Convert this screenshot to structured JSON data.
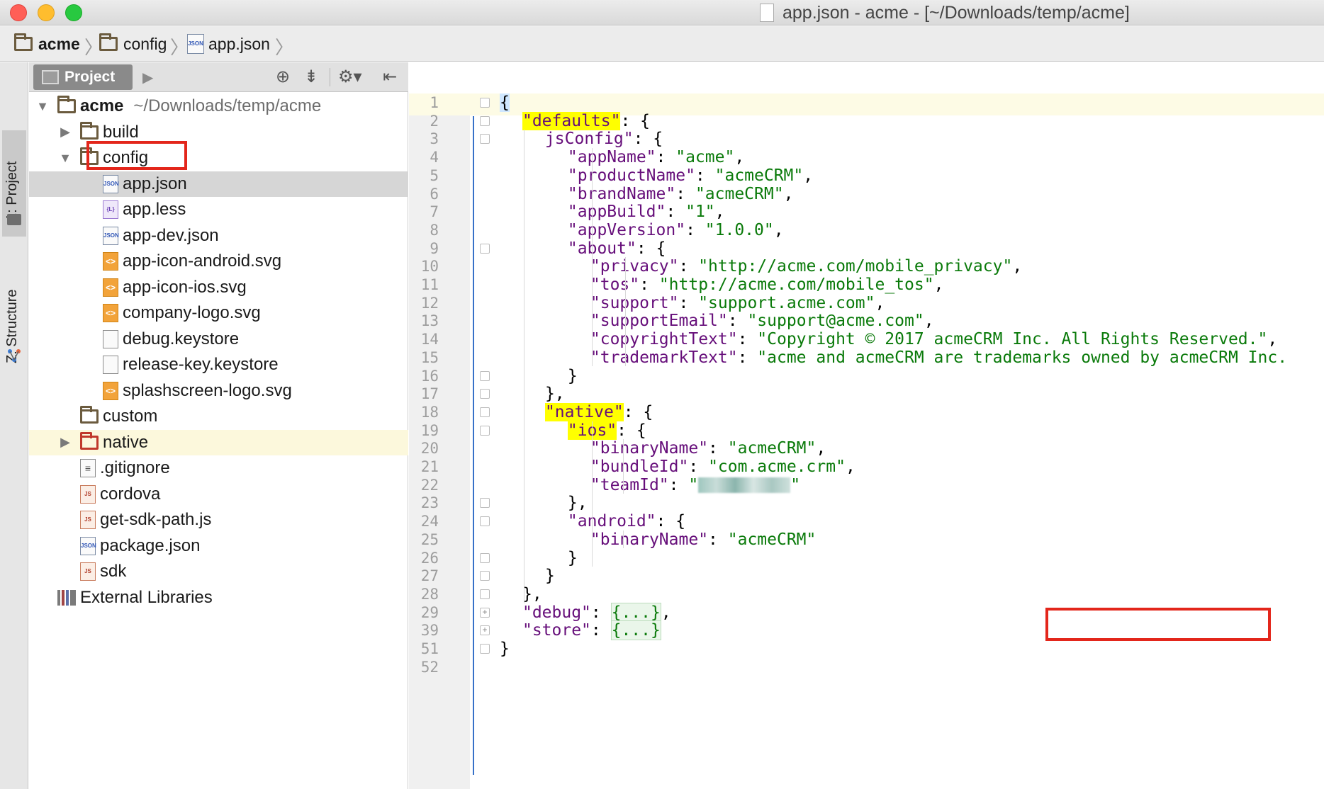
{
  "window": {
    "title": "app.json - acme - [~/Downloads/temp/acme]"
  },
  "breadcrumb": [
    "acme",
    "config",
    "app.json"
  ],
  "tool_strip": {
    "project_tab": "1: Project",
    "structure_tab": "Z: Structure"
  },
  "project_panel": {
    "tab_label": "Project",
    "toolbar_icons": [
      "locate-icon",
      "collapse-all-icon",
      "settings-icon",
      "hide-panel-icon"
    ],
    "tree": [
      {
        "label": "acme",
        "path": "~/Downloads/temp/acme",
        "icon": "folder-icon",
        "arrow": "expanded",
        "indent": 0,
        "bold": true
      },
      {
        "label": "build",
        "path": "",
        "icon": "folder-icon",
        "arrow": "collapsed",
        "indent": 1
      },
      {
        "label": "config",
        "path": "",
        "icon": "folder-icon",
        "arrow": "expanded",
        "indent": 1
      },
      {
        "label": "app.json",
        "path": "",
        "icon": "json-file-icon",
        "arrow": "none",
        "indent": 2,
        "selected": true
      },
      {
        "label": "app.less",
        "path": "",
        "icon": "less-file-icon",
        "arrow": "none",
        "indent": 2
      },
      {
        "label": "app-dev.json",
        "path": "",
        "icon": "json-file-icon",
        "arrow": "none",
        "indent": 2
      },
      {
        "label": "app-icon-android.svg",
        "path": "",
        "icon": "svg-file-icon",
        "arrow": "none",
        "indent": 2
      },
      {
        "label": "app-icon-ios.svg",
        "path": "",
        "icon": "svg-file-icon",
        "arrow": "none",
        "indent": 2
      },
      {
        "label": "company-logo.svg",
        "path": "",
        "icon": "svg-file-icon",
        "arrow": "none",
        "indent": 2
      },
      {
        "label": "debug.keystore",
        "path": "",
        "icon": "plain-file-icon",
        "arrow": "none",
        "indent": 2
      },
      {
        "label": "release-key.keystore",
        "path": "",
        "icon": "plain-file-icon",
        "arrow": "none",
        "indent": 2
      },
      {
        "label": "splashscreen-logo.svg",
        "path": "",
        "icon": "svg-file-icon",
        "arrow": "none",
        "indent": 2
      },
      {
        "label": "custom",
        "path": "",
        "icon": "folder-icon",
        "arrow": "none",
        "indent": 1
      },
      {
        "label": "native",
        "path": "",
        "icon": "excluded-folder-icon",
        "arrow": "collapsed",
        "indent": 1,
        "excluded": true
      },
      {
        "label": ".gitignore",
        "path": "",
        "icon": "text-file-icon",
        "arrow": "none",
        "indent": 1
      },
      {
        "label": "cordova",
        "path": "",
        "icon": "js-file-icon",
        "arrow": "none",
        "indent": 1
      },
      {
        "label": "get-sdk-path.js",
        "path": "",
        "icon": "js-file-icon",
        "arrow": "none",
        "indent": 1
      },
      {
        "label": "package.json",
        "path": "",
        "icon": "json-file-icon",
        "arrow": "none",
        "indent": 1
      },
      {
        "label": "sdk",
        "path": "",
        "icon": "js-file-icon",
        "arrow": "none",
        "indent": 1
      },
      {
        "label": "External Libraries",
        "path": "",
        "icon": "library-icon",
        "arrow": "none",
        "indent": 0
      }
    ]
  },
  "editor": {
    "lines": [
      {
        "n": "1",
        "fold": "open",
        "indent": 0,
        "parts": [
          [
            "br",
            "{"
          ]
        ]
      },
      {
        "n": "2",
        "fold": "open",
        "indent": 2,
        "parts": [
          [
            "k hl",
            "\"defaults\""
          ],
          [
            "p",
            ": {"
          ]
        ]
      },
      {
        "n": "3",
        "fold": "open",
        "indent": 4,
        "parts": [
          [
            "k",
            "jsConfig\""
          ],
          [
            "p",
            ": {"
          ]
        ]
      },
      {
        "n": "4",
        "fold": "",
        "indent": 6,
        "parts": [
          [
            "k",
            "\"appName\""
          ],
          [
            "p",
            ": "
          ],
          [
            "s",
            "\"acme\""
          ],
          [
            "p",
            ","
          ]
        ]
      },
      {
        "n": "5",
        "fold": "",
        "indent": 6,
        "parts": [
          [
            "k",
            "\"productName\""
          ],
          [
            "p",
            ": "
          ],
          [
            "s",
            "\"acmeCRM\""
          ],
          [
            "p",
            ","
          ]
        ]
      },
      {
        "n": "6",
        "fold": "",
        "indent": 6,
        "parts": [
          [
            "k",
            "\"brandName\""
          ],
          [
            "p",
            ": "
          ],
          [
            "s",
            "\"acmeCRM\""
          ],
          [
            "p",
            ","
          ]
        ]
      },
      {
        "n": "7",
        "fold": "",
        "indent": 6,
        "parts": [
          [
            "k",
            "\"appBuild\""
          ],
          [
            "p",
            ": "
          ],
          [
            "s",
            "\"1\""
          ],
          [
            "p",
            ","
          ]
        ]
      },
      {
        "n": "8",
        "fold": "",
        "indent": 6,
        "parts": [
          [
            "k",
            "\"appVersion\""
          ],
          [
            "p",
            ": "
          ],
          [
            "s",
            "\"1.0.0\""
          ],
          [
            "p",
            ","
          ]
        ]
      },
      {
        "n": "9",
        "fold": "open",
        "indent": 6,
        "parts": [
          [
            "k",
            "\"about\""
          ],
          [
            "p",
            ": {"
          ]
        ]
      },
      {
        "n": "10",
        "fold": "",
        "indent": 8,
        "parts": [
          [
            "k",
            "\"privacy\""
          ],
          [
            "p",
            ": "
          ],
          [
            "s",
            "\"http://acme.com/mobile_privacy\""
          ],
          [
            "p",
            ","
          ]
        ]
      },
      {
        "n": "11",
        "fold": "",
        "indent": 8,
        "parts": [
          [
            "k",
            "\"tos\""
          ],
          [
            "p",
            ": "
          ],
          [
            "s",
            "\"http://acme.com/mobile_tos\""
          ],
          [
            "p",
            ","
          ]
        ]
      },
      {
        "n": "12",
        "fold": "",
        "indent": 8,
        "parts": [
          [
            "k",
            "\"support\""
          ],
          [
            "p",
            ": "
          ],
          [
            "s",
            "\"support.acme.com\""
          ],
          [
            "p",
            ","
          ]
        ]
      },
      {
        "n": "13",
        "fold": "",
        "indent": 8,
        "parts": [
          [
            "k",
            "\"supportEmail\""
          ],
          [
            "p",
            ": "
          ],
          [
            "s",
            "\"support@acme.com\""
          ],
          [
            "p",
            ","
          ]
        ]
      },
      {
        "n": "14",
        "fold": "",
        "indent": 8,
        "parts": [
          [
            "k",
            "\"copyrightText\""
          ],
          [
            "p",
            ": "
          ],
          [
            "s",
            "\"Copyright © 2017 acmeCRM Inc. All Rights Reserved.\""
          ],
          [
            "p",
            ","
          ]
        ]
      },
      {
        "n": "15",
        "fold": "",
        "indent": 8,
        "parts": [
          [
            "k",
            "\"trademarkText\""
          ],
          [
            "p",
            ": "
          ],
          [
            "s",
            "\"acme and acmeCRM are trademarks owned by acmeCRM Inc."
          ]
        ]
      },
      {
        "n": "16",
        "fold": "close",
        "indent": 6,
        "parts": [
          [
            "p",
            "}"
          ]
        ]
      },
      {
        "n": "17",
        "fold": "close",
        "indent": 4,
        "parts": [
          [
            "p",
            "},"
          ]
        ]
      },
      {
        "n": "18",
        "fold": "open",
        "indent": 4,
        "parts": [
          [
            "k hl",
            "\"native\""
          ],
          [
            "p",
            ": {"
          ]
        ]
      },
      {
        "n": "19",
        "fold": "open",
        "indent": 6,
        "parts": [
          [
            "k hl",
            "\"ios\""
          ],
          [
            "p",
            ": {"
          ]
        ]
      },
      {
        "n": "20",
        "fold": "",
        "indent": 8,
        "parts": [
          [
            "k",
            "\"binaryName\""
          ],
          [
            "p",
            ": "
          ],
          [
            "s",
            "\"acmeCRM\""
          ],
          [
            "p",
            ","
          ]
        ]
      },
      {
        "n": "21",
        "fold": "",
        "indent": 8,
        "parts": [
          [
            "k",
            "\"bundleId\""
          ],
          [
            "p",
            ": "
          ],
          [
            "s",
            "\"com.acme.crm\""
          ],
          [
            "p",
            ","
          ]
        ]
      },
      {
        "n": "22",
        "fold": "",
        "indent": 8,
        "parts": [
          [
            "k",
            "\"teamId\""
          ],
          [
            "p",
            ": "
          ],
          [
            "s",
            "\""
          ],
          [
            "blur",
            ""
          ],
          [
            "s",
            "\""
          ]
        ]
      },
      {
        "n": "23",
        "fold": "close",
        "indent": 6,
        "parts": [
          [
            "p",
            "},"
          ]
        ]
      },
      {
        "n": "24",
        "fold": "open",
        "indent": 6,
        "parts": [
          [
            "k",
            "\"android\""
          ],
          [
            "p",
            ": {"
          ]
        ]
      },
      {
        "n": "25",
        "fold": "",
        "indent": 8,
        "parts": [
          [
            "k",
            "\"binaryName\""
          ],
          [
            "p",
            ": "
          ],
          [
            "s",
            "\"acmeCRM\""
          ]
        ]
      },
      {
        "n": "26",
        "fold": "close",
        "indent": 6,
        "parts": [
          [
            "p",
            "}"
          ]
        ]
      },
      {
        "n": "27",
        "fold": "close",
        "indent": 4,
        "parts": [
          [
            "p",
            "}"
          ]
        ]
      },
      {
        "n": "28",
        "fold": "close",
        "indent": 2,
        "parts": [
          [
            "p",
            "},"
          ]
        ]
      },
      {
        "n": "29",
        "fold": "plus",
        "indent": 2,
        "parts": [
          [
            "k",
            "\"debug\""
          ],
          [
            "p",
            ": "
          ],
          [
            "collapsed",
            "{...}"
          ],
          [
            "p",
            ","
          ]
        ]
      },
      {
        "n": "39",
        "fold": "plus",
        "indent": 2,
        "parts": [
          [
            "k",
            "\"store\""
          ],
          [
            "p",
            ": "
          ],
          [
            "collapsed",
            "{...}"
          ]
        ]
      },
      {
        "n": "51",
        "fold": "close",
        "indent": 0,
        "parts": [
          [
            "p",
            "}"
          ]
        ]
      },
      {
        "n": "52",
        "fold": "",
        "indent": 0,
        "parts": []
      }
    ]
  },
  "colors": {
    "keyword": "#660e7a",
    "string": "#0a7a0a",
    "highlight": "#ffff00",
    "annotation_box": "#e3261b"
  }
}
